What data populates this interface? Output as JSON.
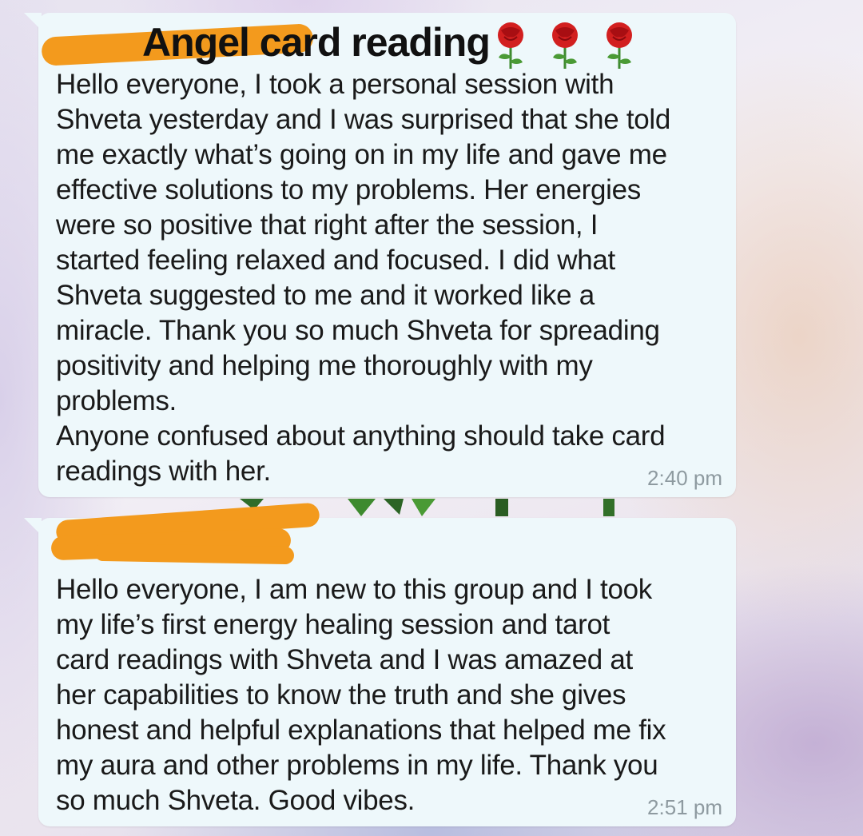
{
  "messages": [
    {
      "sender": "Angel card reading",
      "text": "Hello everyone, I took a personal session with\nShveta yesterday and I was surprised that she told\nme exactly what’s going on in my life and gave me\neffective solutions to my problems. Her energies\nwere so positive that right after the session, I\nstarted feeling relaxed and focused. I did what\nShveta suggested to me and it worked like a\nmiracle. Thank you so much Shveta for spreading\npositivity and helping me thoroughly with my\nproblems.\nAnyone confused about anything should take card\nreadings with her.",
      "time": "2:40 pm"
    },
    {
      "sender": "",
      "text": "Hello everyone, I am new to this group and I took\nmy life’s first energy healing session and tarot\ncard readings with Shveta and I was amazed at\nher capabilities to know the truth and she gives\nhonest and helpful explanations that helped me fix\nmy aura and other problems in my life. Thank you\nso much Shveta. Good vibes.",
      "time": "2:51 pm"
    }
  ],
  "icons": {
    "sender_emoji": "rose-icon",
    "emoji_count": 3
  },
  "colors": {
    "bubble": "#eef8fb",
    "redaction": "#f39a1d",
    "timestamp": "#8e9aa0",
    "text": "#1a1a1a"
  }
}
